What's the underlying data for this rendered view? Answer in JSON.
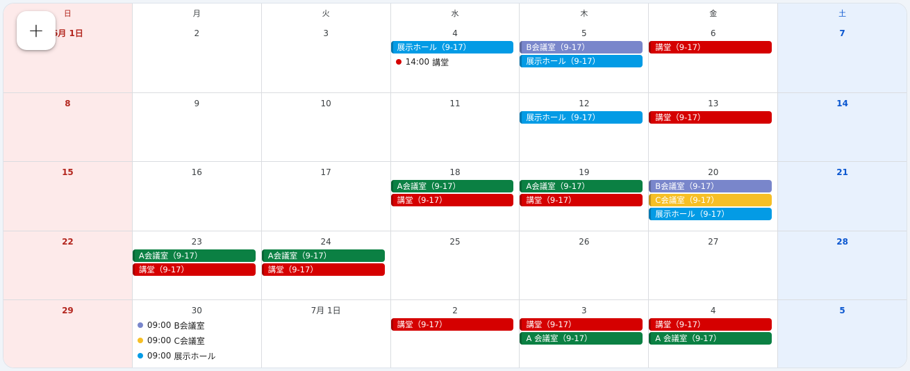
{
  "colors": {
    "green": "#0b8043",
    "red": "#d50000",
    "blue": "#039be5",
    "lavender": "#7986cb",
    "yellow": "#f6bf26"
  },
  "fab": {
    "icon": "plus-icon",
    "symbol": "+"
  },
  "weekdays": [
    "日",
    "月",
    "火",
    "水",
    "木",
    "金",
    "土"
  ],
  "weeks": [
    [
      {
        "num": "6月 1日",
        "events": []
      },
      {
        "num": "2",
        "events": []
      },
      {
        "num": "3",
        "events": []
      },
      {
        "num": "4",
        "events": [
          {
            "type": "chip",
            "label": "展示ホール（9-17）",
            "color": "blue"
          },
          {
            "type": "dot",
            "time": "14:00",
            "label": "講堂",
            "color": "red"
          }
        ]
      },
      {
        "num": "5",
        "events": [
          {
            "type": "chip",
            "label": "B会議室（9-17）",
            "color": "lavender"
          },
          {
            "type": "chip",
            "label": "展示ホール（9-17）",
            "color": "blue"
          }
        ]
      },
      {
        "num": "6",
        "events": [
          {
            "type": "chip",
            "label": "講堂（9-17）",
            "color": "red"
          }
        ]
      },
      {
        "num": "7",
        "events": []
      }
    ],
    [
      {
        "num": "8",
        "events": []
      },
      {
        "num": "9",
        "events": []
      },
      {
        "num": "10",
        "events": []
      },
      {
        "num": "11",
        "events": []
      },
      {
        "num": "12",
        "events": [
          {
            "type": "chip",
            "label": "展示ホール（9-17）",
            "color": "blue"
          }
        ]
      },
      {
        "num": "13",
        "events": [
          {
            "type": "chip",
            "label": "講堂（9-17）",
            "color": "red"
          }
        ]
      },
      {
        "num": "14",
        "events": []
      }
    ],
    [
      {
        "num": "15",
        "events": []
      },
      {
        "num": "16",
        "events": []
      },
      {
        "num": "17",
        "events": []
      },
      {
        "num": "18",
        "events": [
          {
            "type": "chip",
            "label": "A会議室（9-17）",
            "color": "green"
          },
          {
            "type": "chip",
            "label": "講堂（9-17）",
            "color": "red"
          }
        ]
      },
      {
        "num": "19",
        "events": [
          {
            "type": "chip",
            "label": "A会議室（9-17）",
            "color": "green"
          },
          {
            "type": "chip",
            "label": "講堂（9-17）",
            "color": "red"
          }
        ]
      },
      {
        "num": "20",
        "events": [
          {
            "type": "chip",
            "label": "B会議室（9-17）",
            "color": "lavender"
          },
          {
            "type": "chip",
            "label": "C会議室（9-17）",
            "color": "yellow"
          },
          {
            "type": "chip",
            "label": "展示ホール（9-17）",
            "color": "blue"
          }
        ]
      },
      {
        "num": "21",
        "events": []
      }
    ],
    [
      {
        "num": "22",
        "events": []
      },
      {
        "num": "23",
        "events": [
          {
            "type": "chip",
            "label": "A会議室（9-17）",
            "color": "green"
          },
          {
            "type": "chip",
            "label": "講堂（9-17）",
            "color": "red"
          }
        ]
      },
      {
        "num": "24",
        "events": [
          {
            "type": "chip",
            "label": "A会議室（9-17）",
            "color": "green"
          },
          {
            "type": "chip",
            "label": "講堂（9-17）",
            "color": "red"
          }
        ]
      },
      {
        "num": "25",
        "events": []
      },
      {
        "num": "26",
        "events": []
      },
      {
        "num": "27",
        "events": []
      },
      {
        "num": "28",
        "events": []
      }
    ],
    [
      {
        "num": "29",
        "events": []
      },
      {
        "num": "30",
        "events": [
          {
            "type": "dot",
            "time": "09:00",
            "label": "B会議室",
            "color": "lavender"
          },
          {
            "type": "dot",
            "time": "09:00",
            "label": "C会議室",
            "color": "yellow"
          },
          {
            "type": "dot",
            "time": "09:00",
            "label": "展示ホール",
            "color": "blue"
          }
        ]
      },
      {
        "num": "7月 1日",
        "events": []
      },
      {
        "num": "2",
        "events": [
          {
            "type": "chip",
            "label": "講堂（9-17）",
            "color": "red"
          }
        ]
      },
      {
        "num": "3",
        "events": [
          {
            "type": "chip",
            "label": "講堂（9-17）",
            "color": "red"
          },
          {
            "type": "chip",
            "label": "A 会議室（9-17）",
            "color": "green"
          }
        ]
      },
      {
        "num": "4",
        "events": [
          {
            "type": "chip",
            "label": "講堂（9-17）",
            "color": "red"
          },
          {
            "type": "chip",
            "label": "A 会議室（9-17）",
            "color": "green"
          }
        ]
      },
      {
        "num": "5",
        "events": []
      }
    ]
  ]
}
